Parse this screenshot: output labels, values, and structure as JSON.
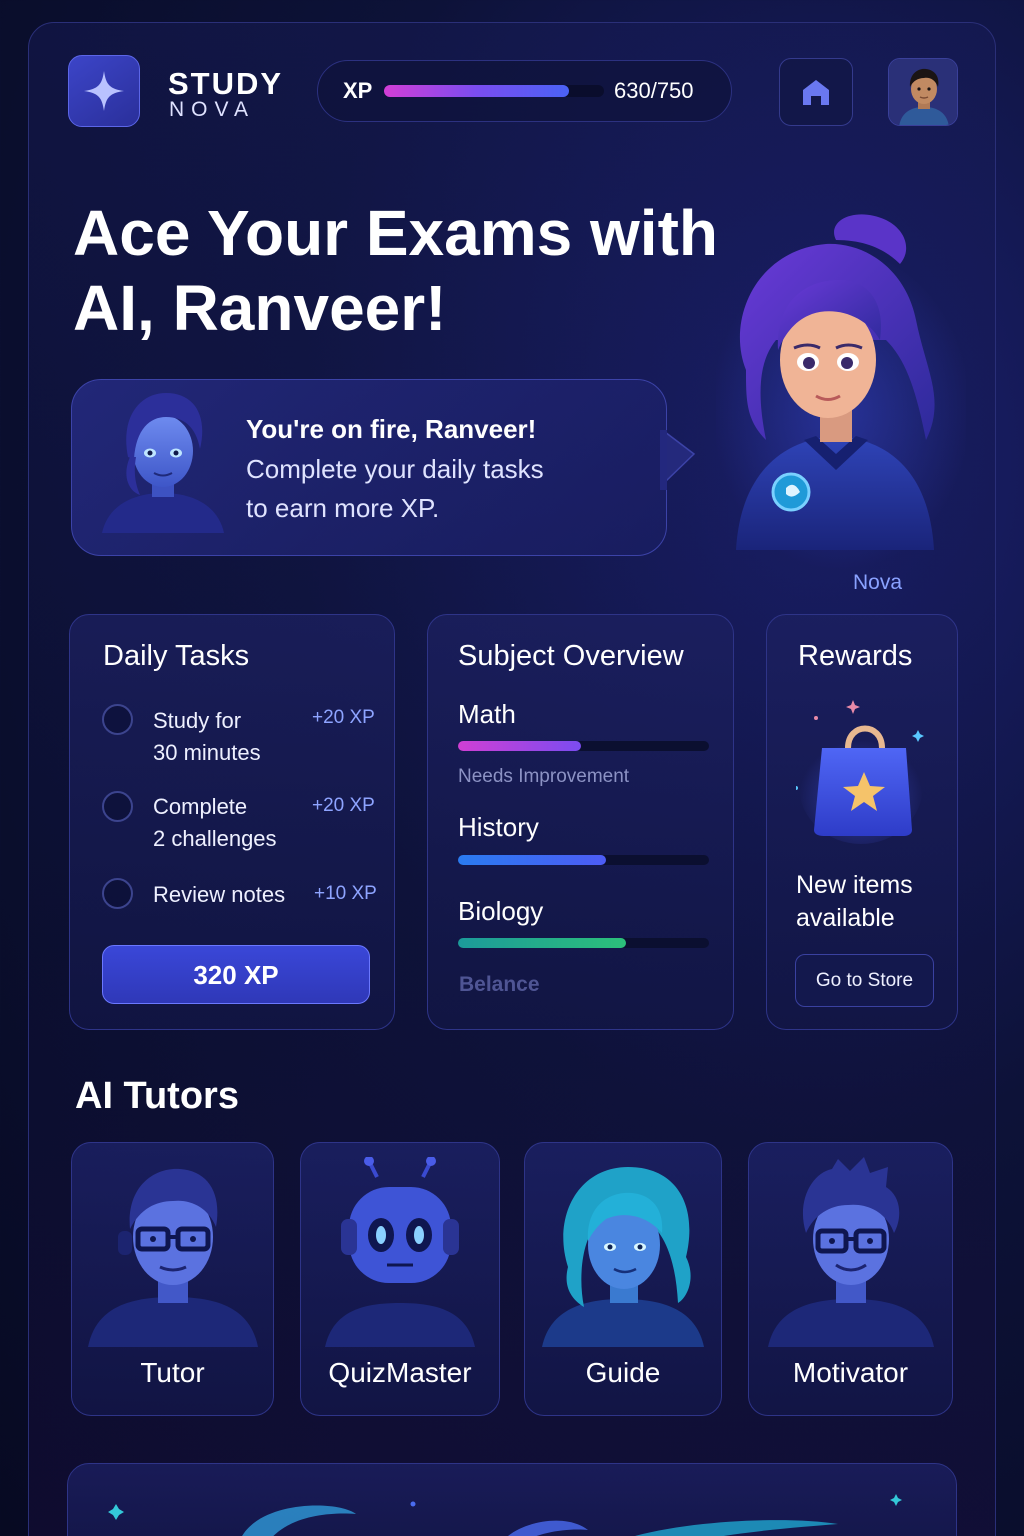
{
  "header": {
    "brand_line1": "STUDY",
    "brand_line2": "NOVA",
    "xp_label": "XP",
    "xp_value_text": "630/750",
    "xp_progress": 0.84,
    "logo_icon": "sparkle-icon",
    "home_icon": "home-icon",
    "avatar": "user-avatar"
  },
  "hero": {
    "title_line1": "Ace Your Exams with",
    "title_line2": "AI, Ranveer!",
    "bubble_line1": "You're on fire, Ranveer!",
    "bubble_line2": "Complete your daily tasks",
    "bubble_line3": "to earn more XP.",
    "companion_name": "Nova"
  },
  "daily_tasks": {
    "title": "Daily Tasks",
    "items": [
      {
        "line1": "Study for",
        "line2": "30 minutes",
        "xp": "+20 XP"
      },
      {
        "line1": "Complete",
        "line2": "2 challenges",
        "xp": "+20 XP"
      },
      {
        "line1": "Review notes",
        "line2": "",
        "xp": "+10 XP"
      }
    ],
    "total_button": "320 XP"
  },
  "subject_overview": {
    "title": "Subject Overview",
    "subjects": [
      {
        "name": "Math",
        "progress": 0.49,
        "note": "Needs Improvement",
        "color_from": "#d03fd4",
        "color_to": "#7b4cf0"
      },
      {
        "name": "History",
        "progress": 0.59,
        "note": "",
        "color_from": "#2a7bf0",
        "color_to": "#4d5cf5"
      },
      {
        "name": "Biology",
        "progress": 0.67,
        "note": "Belance",
        "color_from": "#1c9a9a",
        "color_to": "#2cc07a"
      }
    ]
  },
  "rewards": {
    "title": "Rewards",
    "line1": "New items",
    "line2": "available",
    "button": "Go to Store",
    "icon": "shopping-bag-star-icon"
  },
  "tutors": {
    "title": "AI Tutors",
    "items": [
      {
        "name": "Tutor"
      },
      {
        "name": "QuizMaster"
      },
      {
        "name": "Guide"
      },
      {
        "name": "Motivator"
      }
    ]
  },
  "colors": {
    "accent": "#3a47d8",
    "background": "#0d1238",
    "card_border": "#2e3488",
    "xp_text": "#8ea4ff"
  }
}
